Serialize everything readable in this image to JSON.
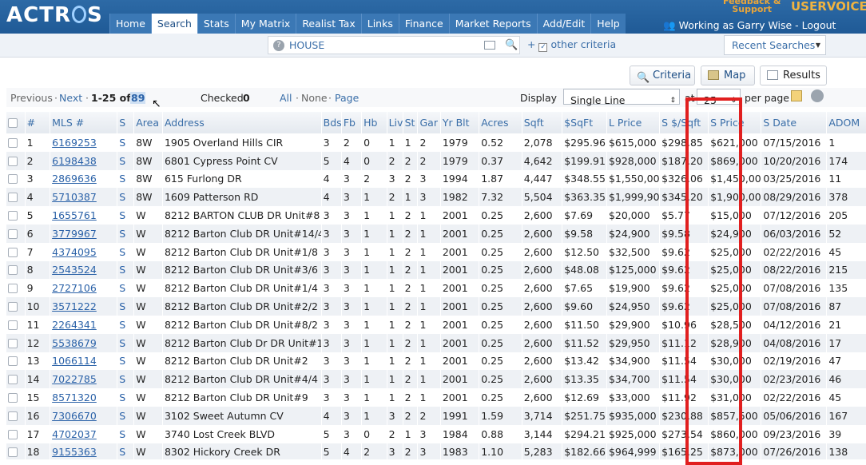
{
  "app": {
    "logo": "ACTR S"
  },
  "nav": {
    "tabs": [
      "Home",
      "Search",
      "Stats",
      "My Matrix",
      "Realist Tax",
      "Links",
      "Finance",
      "Market Reports",
      "Add/Edit",
      "Help"
    ],
    "active": "Search"
  },
  "header": {
    "feedback": "Feedback & Support",
    "uservoice": "USERVOICE",
    "working_as": "Working as Garry Wise - Logout"
  },
  "search": {
    "query": "HOUSE",
    "other_criteria": "other criteria",
    "recent_searches": "Recent Searches"
  },
  "views": {
    "criteria": "Criteria",
    "map": "Map",
    "results": "Results"
  },
  "pager": {
    "previous": "Previous",
    "next": "Next",
    "range": "1-25 of",
    "total": "89",
    "checked_label": "Checked",
    "checked_count": "0",
    "all": "All",
    "none": "None",
    "page": "Page",
    "display_label": "Display",
    "display_value": "Single Line",
    "at_label": "at",
    "per_page_value": "25",
    "per_page_label": "per page"
  },
  "table": {
    "headers": [
      "#",
      "MLS #",
      "S",
      "Area",
      "Address",
      "Bds",
      "Fb",
      "Hb",
      "Liv",
      "St",
      "Gar",
      "Yr Blt",
      "Acres",
      "Sqft",
      "$SqFt",
      "L Price",
      "S $/Sqft",
      "S Price",
      "S Date",
      "ADOM"
    ],
    "rows": [
      [
        "1",
        "6169253",
        "S",
        "8W",
        "1905 Overland Hills CIR",
        "3",
        "2",
        "0",
        "1",
        "1",
        "2",
        "1979",
        "0.52",
        "2,078",
        "$295.96",
        "$615,000",
        "$298.85",
        "$621,000",
        "07/15/2016",
        "1"
      ],
      [
        "2",
        "6198438",
        "S",
        "8W",
        "6801 Cypress Point CV",
        "5",
        "4",
        "0",
        "2",
        "2",
        "2",
        "1979",
        "0.37",
        "4,642",
        "$199.91",
        "$928,000",
        "$187.20",
        "$869,000",
        "10/20/2016",
        "174"
      ],
      [
        "3",
        "2869636",
        "S",
        "8W",
        "615 Furlong DR",
        "4",
        "3",
        "2",
        "3",
        "2",
        "3",
        "1994",
        "1.87",
        "4,447",
        "$348.55",
        "$1,550,00",
        "$326.06",
        "$1,450,00",
        "03/25/2016",
        "11"
      ],
      [
        "4",
        "5710387",
        "S",
        "8W",
        "1609 Patterson RD",
        "4",
        "3",
        "1",
        "2",
        "1",
        "3",
        "1982",
        "7.32",
        "5,504",
        "$363.35",
        "$1,999,90",
        "$345.20",
        "$1,900,00",
        "08/29/2016",
        "378"
      ],
      [
        "5",
        "1655761",
        "S",
        "W",
        "8212 BARTON CLUB DR Unit#8",
        "3",
        "3",
        "1",
        "1",
        "2",
        "1",
        "2001",
        "0.25",
        "2,600",
        "$7.69",
        "$20,000",
        "$5.77",
        "$15,000",
        "07/12/2016",
        "205"
      ],
      [
        "6",
        "3779967",
        "S",
        "W",
        "8212 Barton Club DR Unit#14/4",
        "3",
        "3",
        "1",
        "1",
        "2",
        "1",
        "2001",
        "0.25",
        "2,600",
        "$9.58",
        "$24,900",
        "$9.58",
        "$24,900",
        "06/03/2016",
        "52"
      ],
      [
        "7",
        "4374095",
        "S",
        "W",
        "8212 Barton Club DR Unit#1/8",
        "3",
        "3",
        "1",
        "1",
        "2",
        "1",
        "2001",
        "0.25",
        "2,600",
        "$12.50",
        "$32,500",
        "$9.62",
        "$25,000",
        "02/22/2016",
        "45"
      ],
      [
        "8",
        "2543524",
        "S",
        "W",
        "8212 Barton Club DR Unit#3/6",
        "3",
        "3",
        "1",
        "1",
        "2",
        "1",
        "2001",
        "0.25",
        "2,600",
        "$48.08",
        "$125,000",
        "$9.62",
        "$25,000",
        "08/22/2016",
        "215"
      ],
      [
        "9",
        "2727106",
        "S",
        "W",
        "8212 Barton Club DR Unit#1/4",
        "3",
        "3",
        "1",
        "1",
        "2",
        "1",
        "2001",
        "0.25",
        "2,600",
        "$7.65",
        "$19,900",
        "$9.62",
        "$25,000",
        "07/08/2016",
        "135"
      ],
      [
        "10",
        "3571222",
        "S",
        "W",
        "8212 Barton Club DR Unit#2/2",
        "3",
        "3",
        "1",
        "1",
        "2",
        "1",
        "2001",
        "0.25",
        "2,600",
        "$9.60",
        "$24,950",
        "$9.62",
        "$25,000",
        "07/08/2016",
        "87"
      ],
      [
        "11",
        "2264341",
        "S",
        "W",
        "8212 Barton Club DR Unit#8/2",
        "3",
        "3",
        "1",
        "1",
        "2",
        "1",
        "2001",
        "0.25",
        "2,600",
        "$11.50",
        "$29,900",
        "$10.96",
        "$28,500",
        "04/12/2016",
        "21"
      ],
      [
        "12",
        "5538679",
        "S",
        "W",
        "8212 Barton Club Dr DR Unit#1",
        "3",
        "3",
        "1",
        "1",
        "2",
        "1",
        "2001",
        "0.25",
        "2,600",
        "$11.52",
        "$29,950",
        "$11.12",
        "$28,900",
        "04/08/2016",
        "17"
      ],
      [
        "13",
        "1066114",
        "S",
        "W",
        "8212 Barton Club DR Unit#2",
        "3",
        "3",
        "1",
        "1",
        "2",
        "1",
        "2001",
        "0.25",
        "2,600",
        "$13.42",
        "$34,900",
        "$11.54",
        "$30,000",
        "02/19/2016",
        "47"
      ],
      [
        "14",
        "7022785",
        "S",
        "W",
        "8212 Barton Club DR Unit#4/4",
        "3",
        "3",
        "1",
        "1",
        "2",
        "1",
        "2001",
        "0.25",
        "2,600",
        "$13.35",
        "$34,700",
        "$11.54",
        "$30,000",
        "02/23/2016",
        "46"
      ],
      [
        "15",
        "8571320",
        "S",
        "W",
        "8212 Barton Club DR Unit#9",
        "3",
        "3",
        "1",
        "1",
        "2",
        "1",
        "2001",
        "0.25",
        "2,600",
        "$12.69",
        "$33,000",
        "$11.92",
        "$31,000",
        "02/22/2016",
        "45"
      ],
      [
        "16",
        "7306670",
        "S",
        "W",
        "3102 Sweet Autumn CV",
        "4",
        "3",
        "1",
        "3",
        "2",
        "2",
        "1991",
        "1.59",
        "3,714",
        "$251.75",
        "$935,000",
        "$230.88",
        "$857,500",
        "05/06/2016",
        "167"
      ],
      [
        "17",
        "4702037",
        "S",
        "W",
        "3740 Lost Creek BLVD",
        "5",
        "3",
        "0",
        "2",
        "1",
        "3",
        "1984",
        "0.88",
        "3,144",
        "$294.21",
        "$925,000",
        "$273.54",
        "$860,000",
        "09/23/2016",
        "39"
      ],
      [
        "18",
        "9155363",
        "S",
        "W",
        "8302 Hickory Creek DR",
        "5",
        "4",
        "2",
        "3",
        "2",
        "3",
        "1983",
        "1.10",
        "5,283",
        "$182.66",
        "$964,999",
        "$165.25",
        "$873,000",
        "07/26/2016",
        "138"
      ]
    ]
  }
}
